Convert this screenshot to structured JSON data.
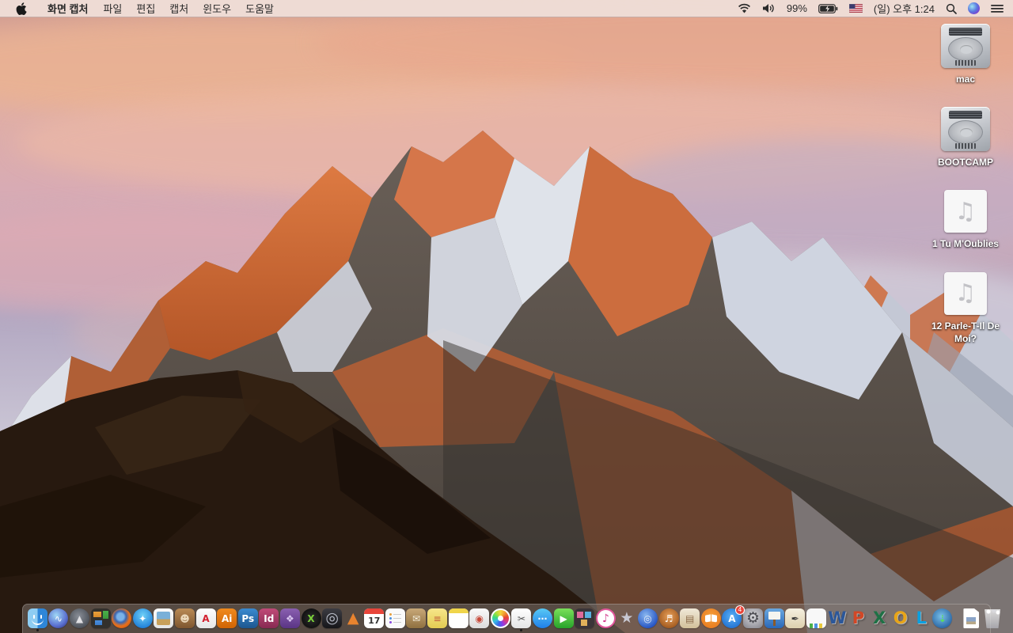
{
  "menubar": {
    "app_menu": "화면 캡처",
    "menus": [
      "파일",
      "편집",
      "캡처",
      "윈도우",
      "도움말"
    ],
    "status": {
      "battery_percent": "99%",
      "clock": "(일) 오후 1:24",
      "icons": [
        "wifi-icon",
        "volume-icon",
        "battery-charging-icon",
        "us-flag-icon",
        "spotlight-search-icon",
        "siri-icon",
        "notification-center-icon"
      ]
    }
  },
  "desktop": {
    "icons": [
      {
        "type": "drive",
        "label": "mac"
      },
      {
        "type": "drive",
        "label": "BOOTCAMP"
      },
      {
        "type": "audio",
        "label": "1 Tu M'Oublies"
      },
      {
        "type": "audio",
        "label": "12 Parle-T-Il De Moi?"
      }
    ]
  },
  "dock": {
    "apps": [
      {
        "name": "finder",
        "cls": "ic-finder",
        "running": true
      },
      {
        "name": "siri",
        "cls": "ic-circle",
        "bg": "radial-gradient(circle at 40% 35%,#9fd8f5,#5a6fd0 60%,#252a6a)",
        "glyph": "∿",
        "fg": "#ffffff"
      },
      {
        "name": "launchpad",
        "cls": "ic-circle",
        "bg": "radial-gradient(circle at 45% 40%,#8a8f98,#4a4f57 75%)",
        "glyph": "▲",
        "fg": "#e0e0e4"
      },
      {
        "name": "mission-control",
        "cls": "ic-mission"
      },
      {
        "name": "firefox",
        "cls": "ic-circle",
        "bg": "radial-gradient(circle at 45% 42%,#7ab2e8 22%,#3a66b0 36%,#e8701a 58%,#c8530d 85%)"
      },
      {
        "name": "safari",
        "cls": "ic-circle",
        "bg": "radial-gradient(circle at 50% 35%,#6fd0f7,#1f7fd8 78%)",
        "glyph": "✦",
        "fg": "#ffffff"
      },
      {
        "name": "preview",
        "cls": "ic-preview"
      },
      {
        "name": "contacts",
        "cls": "ic-square",
        "bg": "linear-gradient(#b98a55,#7e5630)",
        "glyph": "☻",
        "fg": "#ecd9bb"
      },
      {
        "name": "acrobat",
        "cls": "ic-square",
        "bg": "linear-gradient(#fdfdfd,#e6e6e6)",
        "glyph": "A",
        "fg": "#d3202f",
        "bold": true
      },
      {
        "name": "illustrator",
        "cls": "ic-square",
        "bg": "linear-gradient(#f08a1e,#d06405)",
        "glyph": "Ai",
        "fg": "#ffffff",
        "bold": true
      },
      {
        "name": "photoshop",
        "cls": "ic-square",
        "bg": "linear-gradient(#3a8ad0,#1d578f)",
        "glyph": "Ps",
        "fg": "#ffffff",
        "bold": true
      },
      {
        "name": "indesign",
        "cls": "ic-square",
        "bg": "linear-gradient(#c04a78,#872a52)",
        "glyph": "Id",
        "fg": "#ffffff",
        "bold": true
      },
      {
        "name": "toolbox-app",
        "cls": "ic-square",
        "bg": "linear-gradient(#8a5fb0,#5a3585)",
        "glyph": "❖",
        "fg": "#dcc8f2"
      },
      {
        "name": "photo-x-app",
        "cls": "ic-circle",
        "bg": "radial-gradient(circle,#2e2e2e,#050505)",
        "glyph": "X",
        "fg": "#7ad03a",
        "bold": true
      },
      {
        "name": "disk-utility-app",
        "cls": "ic-square",
        "bg": "linear-gradient(#3c3c42,#16161a)",
        "glyph": "◎",
        "fg": "#b8bcc8",
        "big": true
      },
      {
        "name": "vlc",
        "cls": "ic-none",
        "glyph": "▲",
        "fg": "#e8832e",
        "big": true
      },
      {
        "name": "calendar",
        "cls": "ic-calendar",
        "glyph": "17"
      },
      {
        "name": "reminders",
        "cls": "ic-reminders"
      },
      {
        "name": "ballot-box-app",
        "cls": "ic-square",
        "bg": "linear-gradient(#c8a878,#8f7040)",
        "glyph": "✉",
        "fg": "#f5f0e0"
      },
      {
        "name": "stickies",
        "cls": "ic-square",
        "bg": "linear-gradient(#f7e68a,#e3cb52)",
        "glyph": "≡",
        "fg": "#c05a3a"
      },
      {
        "name": "notepad",
        "cls": "ic-notepad"
      },
      {
        "name": "print-doc-app",
        "cls": "ic-square",
        "bg": "linear-gradient(#fafafa,#dcdcdc)",
        "glyph": "◉",
        "fg": "#c84a3a"
      },
      {
        "name": "photos",
        "cls": "ic-photos"
      },
      {
        "name": "grab-screen-capture",
        "cls": "ic-square",
        "bg": "linear-gradient(#ffffff,#e4e4e4)",
        "glyph": "✂",
        "fg": "#555555",
        "running": true
      },
      {
        "name": "messages",
        "cls": "ic-circle",
        "bg": "linear-gradient(#58c8f5,#1f7fe8)",
        "glyph": "⋯",
        "fg": "#ffffff",
        "bold": true
      },
      {
        "name": "facetime",
        "cls": "ic-square",
        "bg": "linear-gradient(#7ae05a,#27a32a)",
        "glyph": "▶",
        "fg": "#ffffff"
      },
      {
        "name": "photo-booth",
        "cls": "ic-booth"
      },
      {
        "name": "itunes",
        "cls": "ic-itunes",
        "glyph": "♪"
      },
      {
        "name": "imovie-star",
        "cls": "ic-none",
        "glyph": "★",
        "fg": "#c8c8d2",
        "big": true
      },
      {
        "name": "dvd-player",
        "cls": "ic-circle",
        "bg": "radial-gradient(circle at 40% 35%,#8ab8f0,#1f4ec0 78%)",
        "glyph": "◎",
        "fg": "#e8eef8"
      },
      {
        "name": "garageband",
        "cls": "ic-circle",
        "bg": "radial-gradient(circle at 50% 40%,#e8a05a,#9a5218 85%)",
        "glyph": "♬",
        "fg": "#ffffff"
      },
      {
        "name": "newsstand-app",
        "cls": "ic-square",
        "bg": "linear-gradient(#f0e8d8,#d2c09a)",
        "glyph": "▤",
        "fg": "#8a6a4a"
      },
      {
        "name": "ibooks",
        "cls": "ic-ibooks"
      },
      {
        "name": "app-store",
        "cls": "ic-circle",
        "bg": "radial-gradient(circle at 50% 40%,#5ab0f5,#1f6fd0 82%)",
        "glyph": "A",
        "fg": "#ffffff",
        "bold": true,
        "badge": "4"
      },
      {
        "name": "system-preferences",
        "cls": "ic-square",
        "bg": "radial-gradient(circle at 50% 40%,#d8d8dc,#8e8e96 85%)",
        "glyph": "⚙",
        "fg": "#4a4a50",
        "big": true
      },
      {
        "name": "keynote",
        "cls": "ic-keynote"
      },
      {
        "name": "pages",
        "cls": "ic-square",
        "bg": "linear-gradient(#f5f0e0,#ddd0ae)",
        "glyph": "✒",
        "fg": "#3a3a3a"
      },
      {
        "name": "numbers",
        "cls": "ic-numbers"
      },
      {
        "name": "word",
        "cls": "ic-letter",
        "glyph": "W",
        "fg": "#2b579a"
      },
      {
        "name": "powerpoint",
        "cls": "ic-letter",
        "glyph": "P",
        "fg": "#d24726"
      },
      {
        "name": "excel",
        "cls": "ic-letter",
        "glyph": "X",
        "fg": "#1e7145"
      },
      {
        "name": "outlook",
        "cls": "ic-letter",
        "glyph": "O",
        "fg": "#e8a518"
      },
      {
        "name": "lync",
        "cls": "ic-letter",
        "glyph": "L",
        "fg": "#0aa0e0"
      },
      {
        "name": "downloader-globe",
        "cls": "ic-circle",
        "bg": "radial-gradient(circle at 45% 40%,#7ac0e8,#235e9e 82%)",
        "glyph": "⇣",
        "fg": "#5ae05a",
        "bold": true
      }
    ],
    "right": [
      {
        "name": "screenshot-file",
        "cls": "ic-docfile"
      },
      {
        "name": "trash-full",
        "cls": "ic-trash"
      }
    ]
  },
  "wallpaper": {
    "name": "macos-sierra-mountain-sunset",
    "palette": {
      "sky_pink": "#e2af9f",
      "sky_lavender": "#b3a8c2",
      "cloud_salmon": "#eab293",
      "rock_sunlit_orange": "#c96a3c",
      "snow": "#dfe3ea",
      "foreground_rock_dark": "#27190f"
    }
  }
}
